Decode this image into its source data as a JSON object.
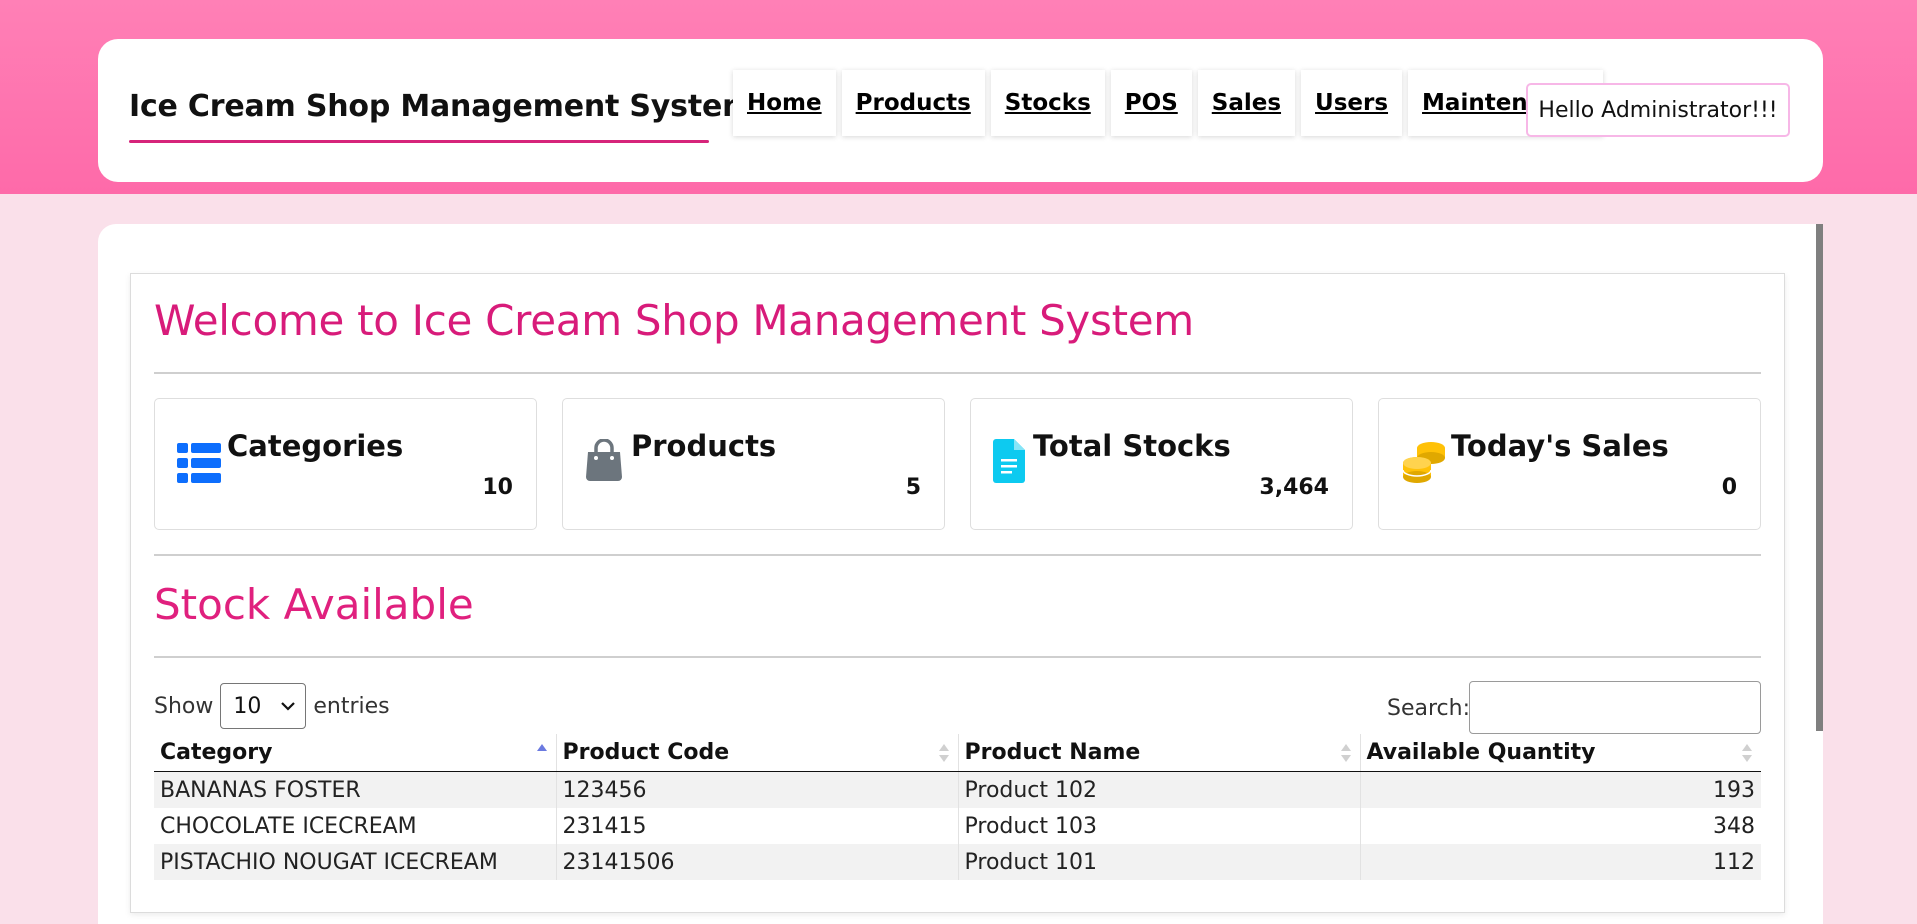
{
  "header": {
    "brand": "Ice Cream Shop Management System",
    "nav": [
      {
        "label": "Home"
      },
      {
        "label": "Products"
      },
      {
        "label": "Stocks"
      },
      {
        "label": "POS"
      },
      {
        "label": "Sales"
      },
      {
        "label": "Users"
      },
      {
        "label": "Maintenance"
      }
    ],
    "greeting": "Hello Administrator!!!"
  },
  "main": {
    "welcome_title": "Welcome to Ice Cream Shop Management System",
    "stats": [
      {
        "label": "Categories",
        "value": "10",
        "icon": "list-icon",
        "color": "#0d6efd"
      },
      {
        "label": "Products",
        "value": "5",
        "icon": "shopping-bag-icon",
        "color": "#6c757d"
      },
      {
        "label": "Total Stocks",
        "value": "3,464",
        "icon": "file-text-icon",
        "color": "#0dcaf0"
      },
      {
        "label": "Today's Sales",
        "value": "0",
        "icon": "coins-icon",
        "color": "#ffc107"
      }
    ],
    "stock_title": "Stock Available",
    "table_controls": {
      "show_label": "Show",
      "entries_value": "10",
      "entries_label": "entries",
      "search_label": "Search:",
      "search_value": ""
    },
    "table": {
      "columns": [
        "Category",
        "Product Code",
        "Product Name",
        "Available Quantity"
      ],
      "rows": [
        [
          "BANANAS FOSTER",
          "123456",
          "Product 102",
          "193"
        ],
        [
          "CHOCOLATE ICECREAM",
          "231415",
          "Product 103",
          "348"
        ],
        [
          "PISTACHIO NOUGAT ICECREAM",
          "23141506",
          "Product 101",
          "112"
        ]
      ]
    }
  }
}
